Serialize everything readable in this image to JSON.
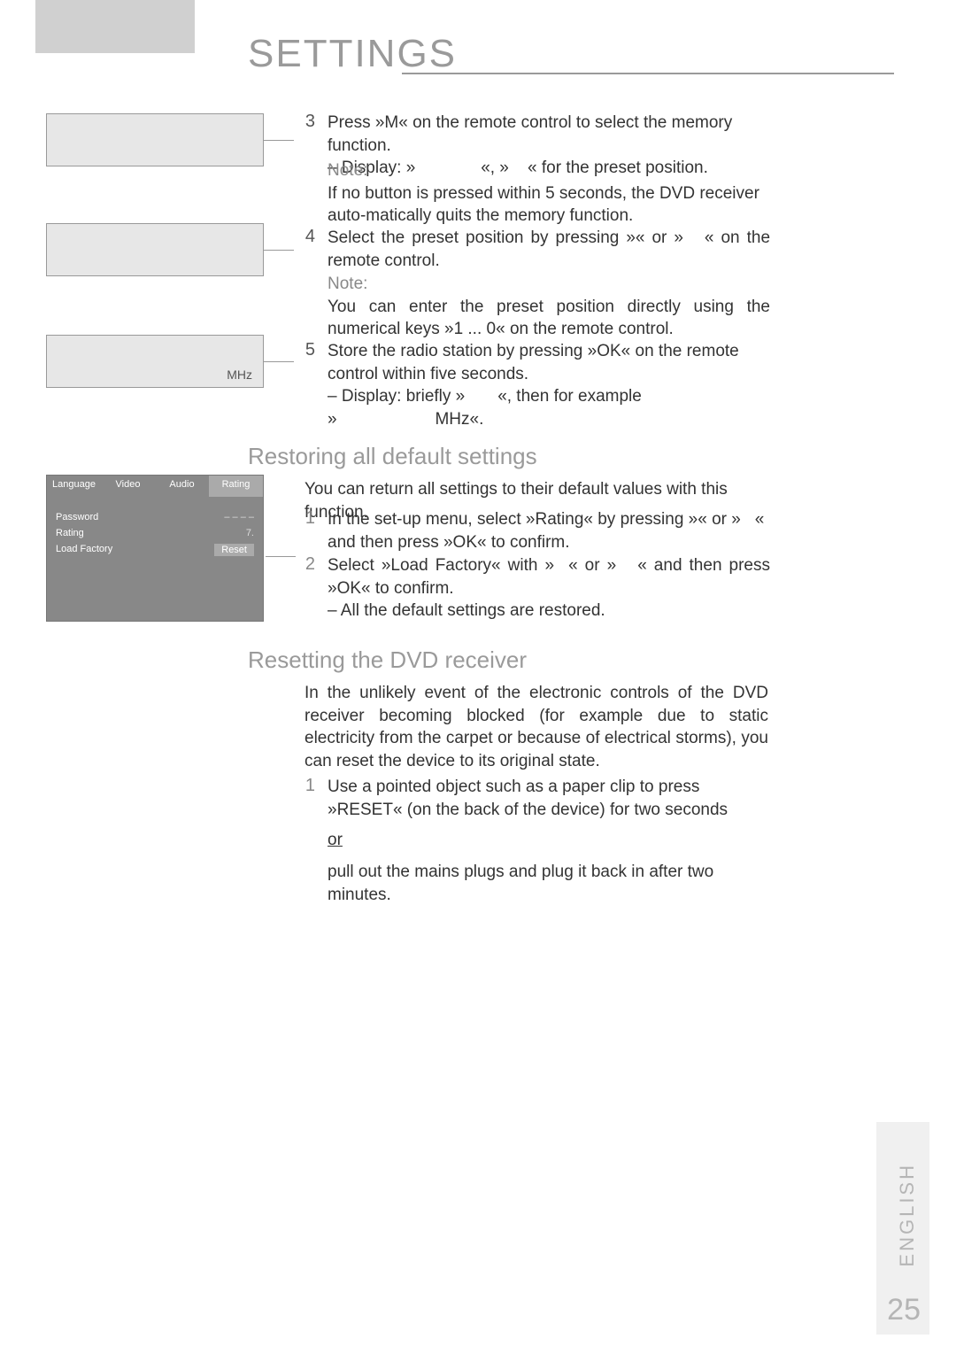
{
  "title": "SETTINGS",
  "display_boxes": {
    "box3_mhz": "MHz"
  },
  "steps_a": {
    "s3_num": "3",
    "s3_line1a": "Press »",
    "s3_m": "M",
    "s3_line1b": "« on the remote control to select the memory function.",
    "s3_line2a": "– Display: »",
    "s3_line2b": "«, »",
    "s3_line2c": "« for the preset position.",
    "s3_note_label": "Note:",
    "s3_note": "If no button is pressed within 5 seconds, the DVD receiver auto-matically quits the memory function.",
    "s4_num": "4",
    "s4_text_a": "Select the preset position by pressing »",
    "s4_text_b": "« or »",
    "s4_text_c": "« on the remote control.",
    "s4_note_label": "Note:",
    "s4_note_a": "You can enter the preset position directly using the numerical keys »",
    "s4_keys": "1 ... 0",
    "s4_note_b": "« on the remote control.",
    "s5_num": "5",
    "s5_text_a": "Store the radio station by pressing",
    "s5_ok": "OK",
    "s5_text_b": "« on the remote control within five seconds.",
    "s5_line2a": "– Display: briefly »",
    "s5_line2b": "«, then for example",
    "s5_line3a": "»",
    "s5_line3b": "MHz",
    "s5_line3c": "«."
  },
  "section_restore": {
    "heading": "Restoring all default settings",
    "intro": "You can return all settings to their default values with this function.",
    "s1_num": "1",
    "s1_a": "In the set-up menu, select »",
    "s1_rating": "Rating",
    "s1_b": "« by pressing »",
    "s1_c": "« or »",
    "s1_d": "« and then press »",
    "s1_ok": "OK",
    "s1_e": "« to confirm.",
    "s2_num": "2",
    "s2_a": "Select »",
    "s2_lf": "Load Factory",
    "s2_b": "« with »",
    "s2_c": "« or »",
    "s2_d": "« and then press »",
    "s2_ok": "OK",
    "s2_e": "« to confirm.",
    "s2_result": "– All the default settings are restored."
  },
  "section_reset": {
    "heading": "Resetting the DVD receiver",
    "intro": "In the unlikely event of the electronic controls of the DVD receiver becoming blocked (for example due to static electricity from the carpet or because of electrical storms), you can reset the device to its original state.",
    "s1_num": "1",
    "s1_a": "Use a pointed object such as a paper clip to press",
    "s1_reset": "RESET",
    "s1_b": "(on the back of the device) for two seconds",
    "or": "or",
    "s1_c": "pull out the mains plugs and plug it back in after two minutes."
  },
  "setup_menu": {
    "tabs": {
      "language": "Language",
      "video": "Video",
      "audio": "Audio",
      "rating": "Rating"
    },
    "rows": {
      "password": "Password",
      "password_val": "– – – –",
      "rating": "Rating",
      "rating_val": "7.",
      "load_factory": "Load Factory",
      "reset": "Reset"
    }
  },
  "footer": {
    "language": "ENGLISH",
    "page": "25"
  }
}
